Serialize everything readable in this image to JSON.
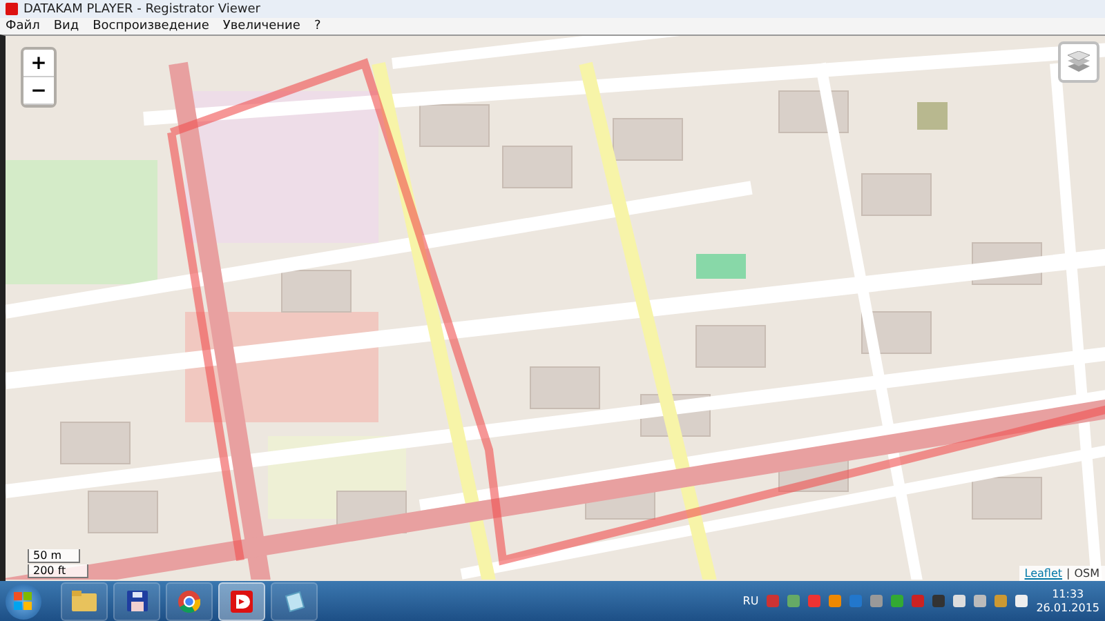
{
  "window": {
    "title": "DATAKAM PLAYER - Registrator Viewer"
  },
  "menu": [
    {
      "label": "Файл"
    },
    {
      "label": "Вид"
    },
    {
      "label": "Воспроизведение"
    },
    {
      "label": "Увеличение"
    },
    {
      "label": "?"
    }
  ],
  "map": {
    "zoom_in": "+",
    "zoom_out": "−",
    "scale": [
      "50 m",
      "200 ft"
    ],
    "attribution": {
      "link": "Leaflet",
      "separator": "|",
      "source": "OSM"
    }
  },
  "taskbar": {
    "apps": [
      {
        "kind": "folder",
        "selected": false
      },
      {
        "kind": "disk",
        "selected": false
      },
      {
        "kind": "browser",
        "selected": false
      },
      {
        "kind": "player",
        "selected": true
      },
      {
        "kind": "notes",
        "selected": false
      }
    ],
    "language": "RU",
    "time": "11:33",
    "date": "26.01.2015"
  }
}
